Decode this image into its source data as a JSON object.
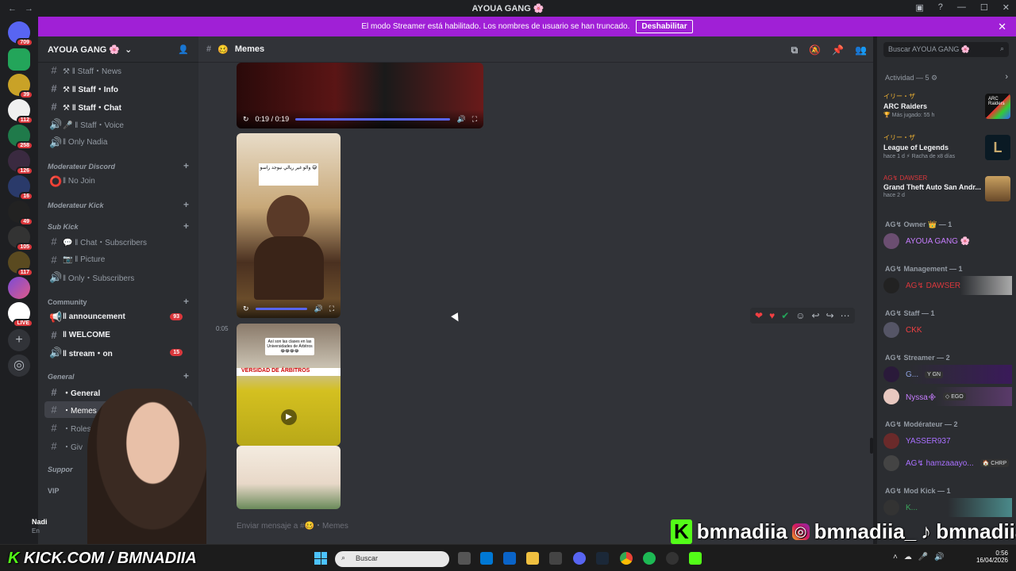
{
  "window": {
    "title": "AYOUA GANG 🌸"
  },
  "banner": {
    "text": "El modo Streamer está habilitado. Los nombres de usuario se han truncado.",
    "button": "Deshabilitar"
  },
  "guild_badges": [
    "709",
    "39",
    "112",
    "258",
    "126",
    "16",
    "49",
    "105",
    "117",
    "LIVE"
  ],
  "server": {
    "name": "AYOUA GANG 🌸"
  },
  "channels": [
    {
      "sym": "#",
      "label": "⚒ ‖ Staff・News",
      "bold": false
    },
    {
      "sym": "#",
      "label": "⚒ ‖ Staff・Info",
      "bold": true
    },
    {
      "sym": "#",
      "label": "⚒ ‖ Staff・Chat",
      "bold": true
    },
    {
      "sym": "🔊",
      "label": "🎤 ‖ Staff・Voice",
      "bold": false
    },
    {
      "sym": "🔊",
      "label": "‖ Only Nadia",
      "bold": false
    }
  ],
  "categories": {
    "mod_discord": "Moderateur Discord",
    "no_join": "‖ No Join",
    "mod_kick": "Moderateur Kick",
    "sub_kick": "Sub Kick",
    "community": "Community",
    "general": "General",
    "support": "Suppor",
    "vip": "VIP"
  },
  "sub_channels": [
    "💬 ‖ Chat・Subscribers",
    "📷 ‖ Picture",
    "‖ Only・Subscribers"
  ],
  "community_channels": [
    {
      "label": "‖ announcement",
      "count": "93"
    },
    {
      "label": "‖ WELCOME",
      "count": ""
    },
    {
      "label": "‖ stream・on",
      "count": "15"
    }
  ],
  "general_channels": [
    "・General",
    "・Memes",
    "・Roles",
    "・Giv"
  ],
  "main": {
    "channel": "Memes",
    "video_time": "0:19 / 0:19",
    "msg_time": "0:05",
    "composer": "Enviar mensaje a #🥴・Memes",
    "overlay_text": "والو غير ريالي نيوجد راسو 😅",
    "overlay_text2": "Así son las clases en las Universidades de Árbitros 😂😂😂😂",
    "overlay_text3": "VERSIDAD DE ÁRBITROS"
  },
  "right": {
    "search": "Buscar AYOUA GANG 🌸",
    "activity_title": "Actividad — 5 ⚙",
    "activities": [
      {
        "user": "イリー・ザ",
        "game": "ARC Raiders",
        "sub": "🏆 Más jugado: 55 h",
        "thumb": "ARC Raiders"
      },
      {
        "user": "イリー・ザ",
        "game": "League of Legends",
        "sub": "hace 1 d  ⚡ Racha de x8 días",
        "thumb": "L"
      },
      {
        "user": "AG↯ DAWSER",
        "game": "Grand Theft Auto San Andr...",
        "sub": "hace 2 d",
        "thumb": ""
      }
    ],
    "roles": [
      {
        "title": "AG↯ Owner 👑 — 1",
        "members": [
          {
            "name": "AYOUA GANG 🌸",
            "color": "#c77dff"
          }
        ]
      },
      {
        "title": "AG↯ Management — 1",
        "members": [
          {
            "name": "AG↯ DAWSER",
            "color": "#da373c"
          }
        ]
      },
      {
        "title": "AG↯ Staff — 1",
        "members": [
          {
            "name": "CKK",
            "color": "#f23f42"
          }
        ]
      },
      {
        "title": "AG↯ Streamer — 2",
        "members": [
          {
            "name": "G...",
            "color": "#8ea1e1",
            "tag": "Y GN"
          },
          {
            "name": "Nyssa᯽",
            "color": "#c77dff",
            "tag": "◇ EGO"
          }
        ]
      },
      {
        "title": "AG↯ Modérateur — 2",
        "members": [
          {
            "name": "YASSER937",
            "color": "#a970ff"
          },
          {
            "name": "AG↯ hamzaaayo...",
            "color": "#a970ff",
            "tag": "🏠 CHRP"
          }
        ]
      },
      {
        "title": "AG↯ Mod Kick — 1",
        "members": [
          {
            "name": "K...",
            "color": "#3ba55d"
          }
        ]
      }
    ]
  },
  "user": {
    "name": "Nadi",
    "status": "En"
  },
  "stream_overlay": {
    "kick": "KICK.COM / BMNADIIA",
    "handle1": "bmnadiia",
    "handle2": "bmnadiia_",
    "handle3": "bmnadiia"
  },
  "taskbar": {
    "search": "Buscar",
    "time": "0:56",
    "date": "16/04/2026"
  }
}
